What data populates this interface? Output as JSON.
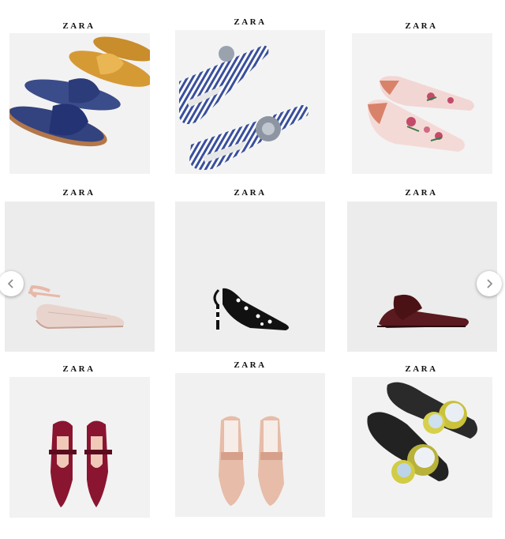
{
  "products": [
    {
      "brand": "ZARA",
      "item": "satin-bow-slide-sandals"
    },
    {
      "brand": "ZARA",
      "item": "striped-jewel-mules"
    },
    {
      "brand": "ZARA",
      "item": "embroidered-floral-loafers"
    },
    {
      "brand": "ZARA",
      "item": "lace-up-ballet-flats"
    },
    {
      "brand": "ZARA",
      "item": "polka-dot-slingback-heels"
    },
    {
      "brand": "ZARA",
      "item": "burgundy-pointed-mules"
    },
    {
      "brand": "ZARA",
      "item": "velvet-mary-jane-flats"
    },
    {
      "brand": "ZARA",
      "item": "pink-satin-loafers"
    },
    {
      "brand": "ZARA",
      "item": "floral-appliqué-slides"
    }
  ],
  "carousel": {
    "prev_icon": "chevron-left-icon",
    "next_icon": "chevron-right-icon"
  },
  "colors": {
    "tile_bg": "#efefef",
    "brand_text": "#111111"
  }
}
